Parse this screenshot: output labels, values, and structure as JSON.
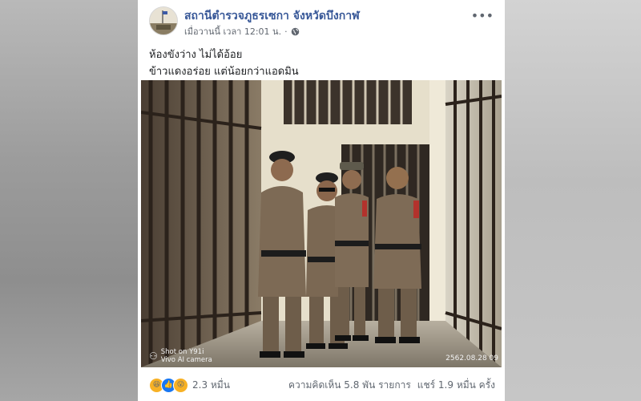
{
  "post": {
    "page_name": "สถานีตำรวจภูธรเซกา จังหวัดบึงกาฬ",
    "time": "เมื่อวานนี้ เวลา 12:01 น.",
    "separator": "·",
    "privacy_icon": "globe-icon",
    "more_label": "•••",
    "caption_line1": "ห้องขังว่าง ไม่ได้อ้อย",
    "caption_line2": "ข้าวแดงอร่อย แต่น้อยกว่าแอดมิน"
  },
  "photo": {
    "watermark_line1": "Shot on Y91i",
    "watermark_line2": "Vivo AI camera",
    "timestamp": "2562.08.28 09"
  },
  "reactions": {
    "icons": [
      "haha-icon",
      "like-icon",
      "wow-icon"
    ],
    "count": "2.3 หมื่น",
    "comments": "ความคิดเห็น 5.8 พัน รายการ",
    "shares": "แชร์ 1.9 หมื่น ครั้ง"
  },
  "colors": {
    "page_name": "#385898",
    "like": "#1877f2",
    "haha": "#f7b125"
  }
}
